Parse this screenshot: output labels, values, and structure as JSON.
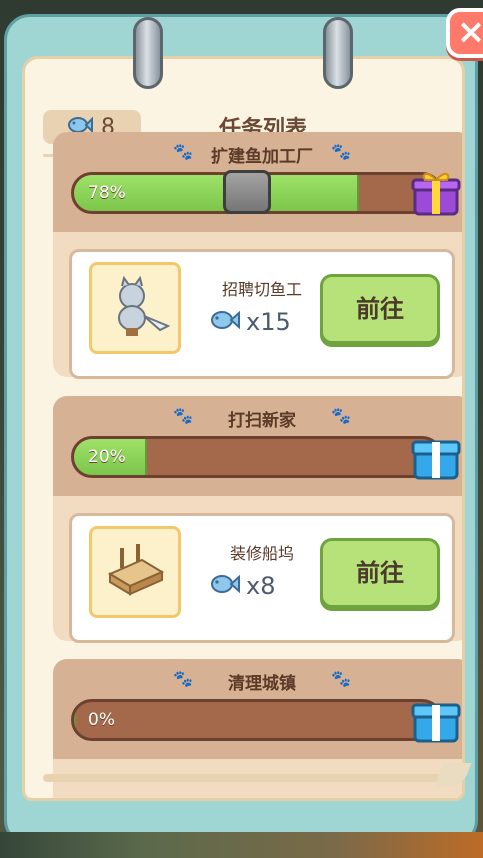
{
  "header": {
    "fish_count": "8",
    "title": "任务列表"
  },
  "close": {
    "icon": "close-icon",
    "label": "×"
  },
  "tasks": [
    {
      "title": "扩建鱼加工厂",
      "progress_pct": 78,
      "progress_label": "78%",
      "reward_chest": "purple-gift-icon",
      "item": {
        "name": "招聘切鱼工",
        "reward_count": "x15",
        "button": "前往"
      }
    },
    {
      "title": "打扫新家",
      "progress_pct": 20,
      "progress_label": "20%",
      "reward_chest": "blue-gift-icon",
      "item": {
        "name": "装修船坞",
        "reward_count": "x8",
        "button": "前往"
      }
    },
    {
      "title": "清理城镇",
      "progress_pct": 0,
      "progress_label": "0%",
      "reward_chest": "blue-gift-icon"
    }
  ],
  "colors": {
    "accent_green": "#b7e27a",
    "frame_teal": "#9fd6d4",
    "card_tan": "#d7b193"
  }
}
